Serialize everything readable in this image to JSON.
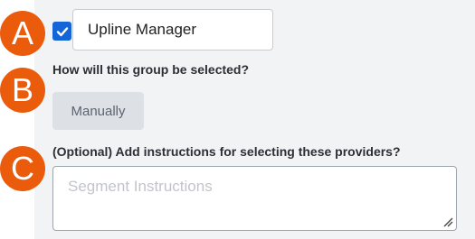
{
  "badges": {
    "a": "A",
    "b": "B",
    "c": "C"
  },
  "group": {
    "checked": true,
    "name_value": "Upline Manager"
  },
  "selection": {
    "question": "How will this group be selected?",
    "method_label": "Manually"
  },
  "instructions": {
    "question": "(Optional) Add instructions for selecting these providers?",
    "placeholder": "Segment Instructions",
    "value": ""
  },
  "icons": {
    "checkbox": "checkmark-icon",
    "resize": "resize-grip-icon"
  },
  "colors": {
    "badge": "#ea5b0c",
    "checkbox": "#1565d8",
    "panel": "#f2f3f5",
    "button": "#dde1e6"
  }
}
